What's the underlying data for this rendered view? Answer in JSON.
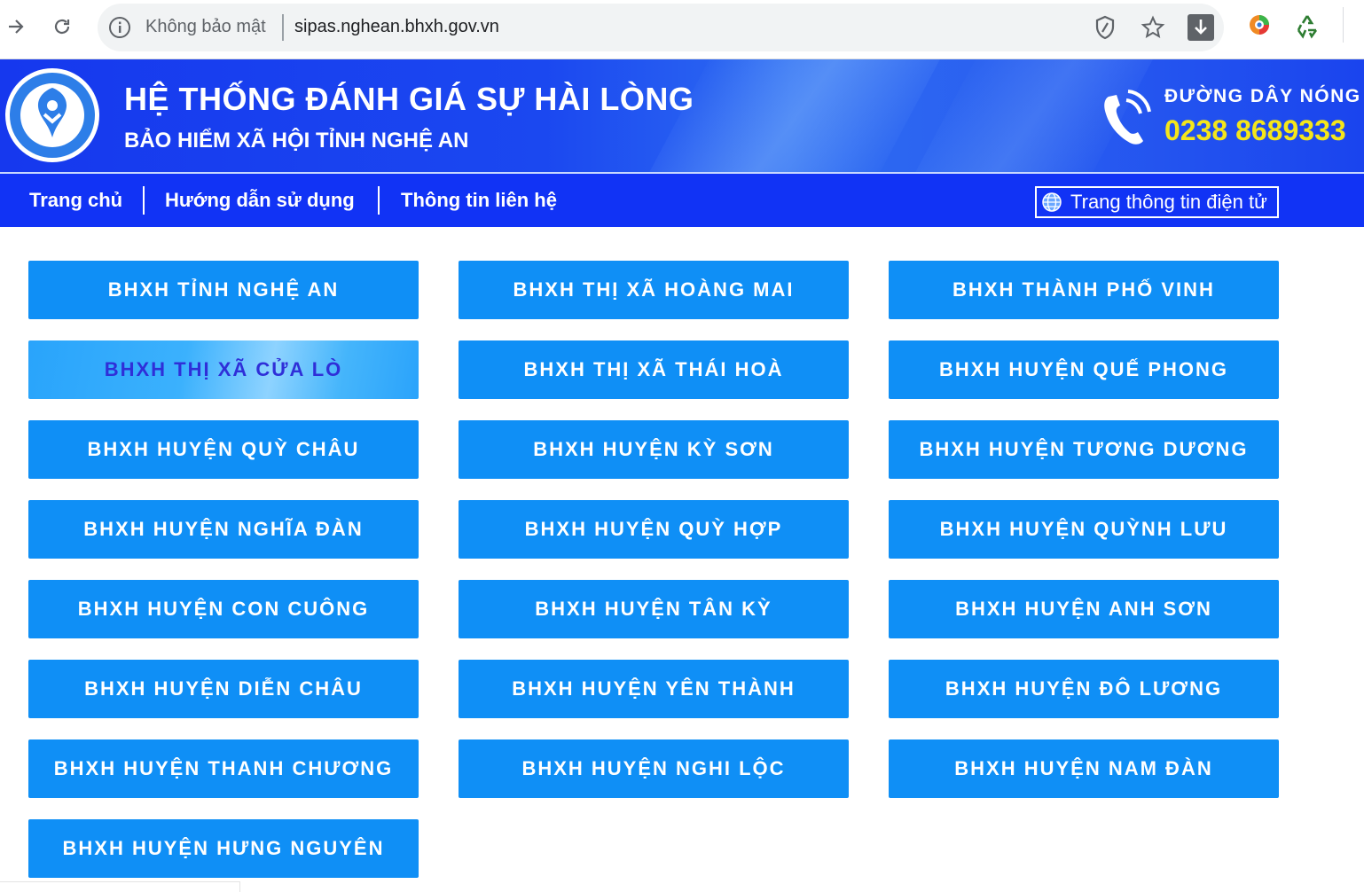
{
  "browser": {
    "security_label": "Không bảo mật",
    "url": "sipas.nghean.bhxh.gov.vn"
  },
  "banner": {
    "title": "HỆ THỐNG ĐÁNH GIÁ SỰ HÀI LÒNG",
    "subtitle": "BẢO HIỂM XÃ HỘI TỈNH NGHỆ AN",
    "hotline_label": "ĐƯỜNG DÂY NÓNG",
    "hotline_number": "0238 8689333"
  },
  "nav": {
    "items": [
      "Trang chủ",
      "Hướng dẫn sử dụng",
      "Thông tin liên hệ"
    ],
    "portal_label": "Trang thông tin điện tử"
  },
  "units": [
    "BHXH TỈNH NGHỆ AN",
    "BHXH THỊ XÃ HOÀNG MAI",
    "BHXH THÀNH PHỐ VINH",
    "BHXH THỊ XÃ CỬA LÒ",
    "BHXH THỊ XÃ THÁI HOÀ",
    "BHXH HUYỆN QUẾ PHONG",
    "BHXH HUYỆN QUỲ CHÂU",
    "BHXH HUYỆN KỲ SƠN",
    "BHXH HUYỆN TƯƠNG DƯƠNG",
    "BHXH HUYỆN NGHĨA ĐÀN",
    "BHXH HUYỆN QUỲ HỢP",
    "BHXH HUYỆN QUỲNH LƯU",
    "BHXH HUYỆN CON CUÔNG",
    "BHXH HUYỆN TÂN KỲ",
    "BHXH HUYỆN ANH SƠN",
    "BHXH HUYỆN DIỄN CHÂU",
    "BHXH HUYỆN YÊN THÀNH",
    "BHXH HUYỆN ĐÔ LƯƠNG",
    "BHXH HUYỆN THANH CHƯƠNG",
    "BHXH HUYỆN NGHI LỘC",
    "BHXH HUYỆN NAM ĐÀN",
    "BHXH HUYỆN HƯNG NGUYÊN"
  ],
  "hovered_unit_index": 3,
  "colors": {
    "button": "#0f8ff6",
    "navbar": "#1133f5",
    "hotline": "#f5e61a"
  }
}
